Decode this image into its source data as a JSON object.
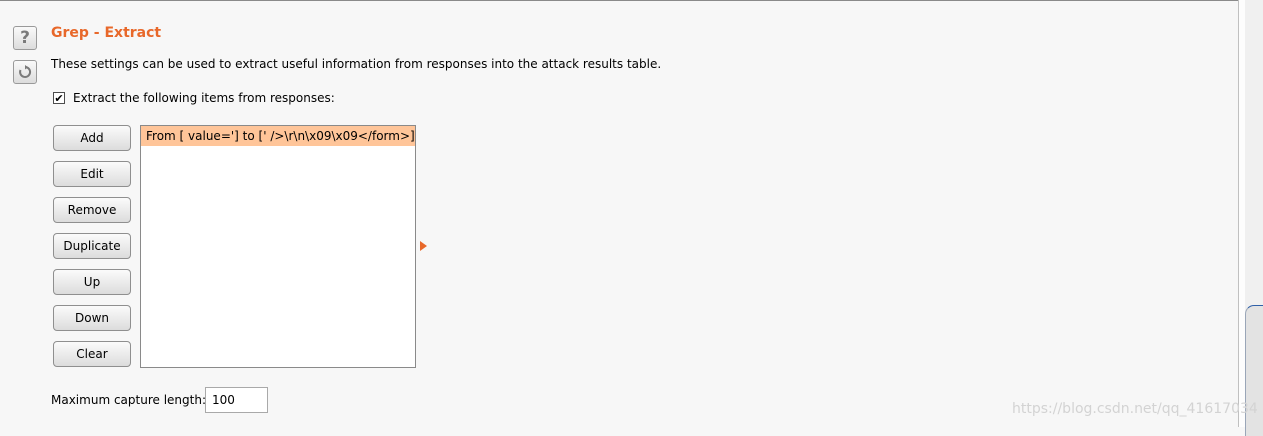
{
  "section": {
    "title": "Grep - Extract",
    "description": "These settings can be used to extract useful information from responses into the attack results table."
  },
  "extract_checkbox": {
    "label": "Extract the following items from responses:",
    "checked": true
  },
  "buttons": {
    "add": "Add",
    "edit": "Edit",
    "remove": "Remove",
    "duplicate": "Duplicate",
    "up": "Up",
    "down": "Down",
    "clear": "Clear"
  },
  "extract_items": [
    "From [ value='] to [' />\\r\\n\\x09\\x09</form>]"
  ],
  "max_capture": {
    "label": "Maximum capture length:",
    "value": "100"
  },
  "watermark": "https://blog.csdn.net/qq_41617034",
  "icons": {
    "help": "help-icon",
    "reset": "reset-icon"
  },
  "colors": {
    "title": "#e8682a",
    "selected_row": "#ffc599",
    "arrow": "#e8682a"
  }
}
